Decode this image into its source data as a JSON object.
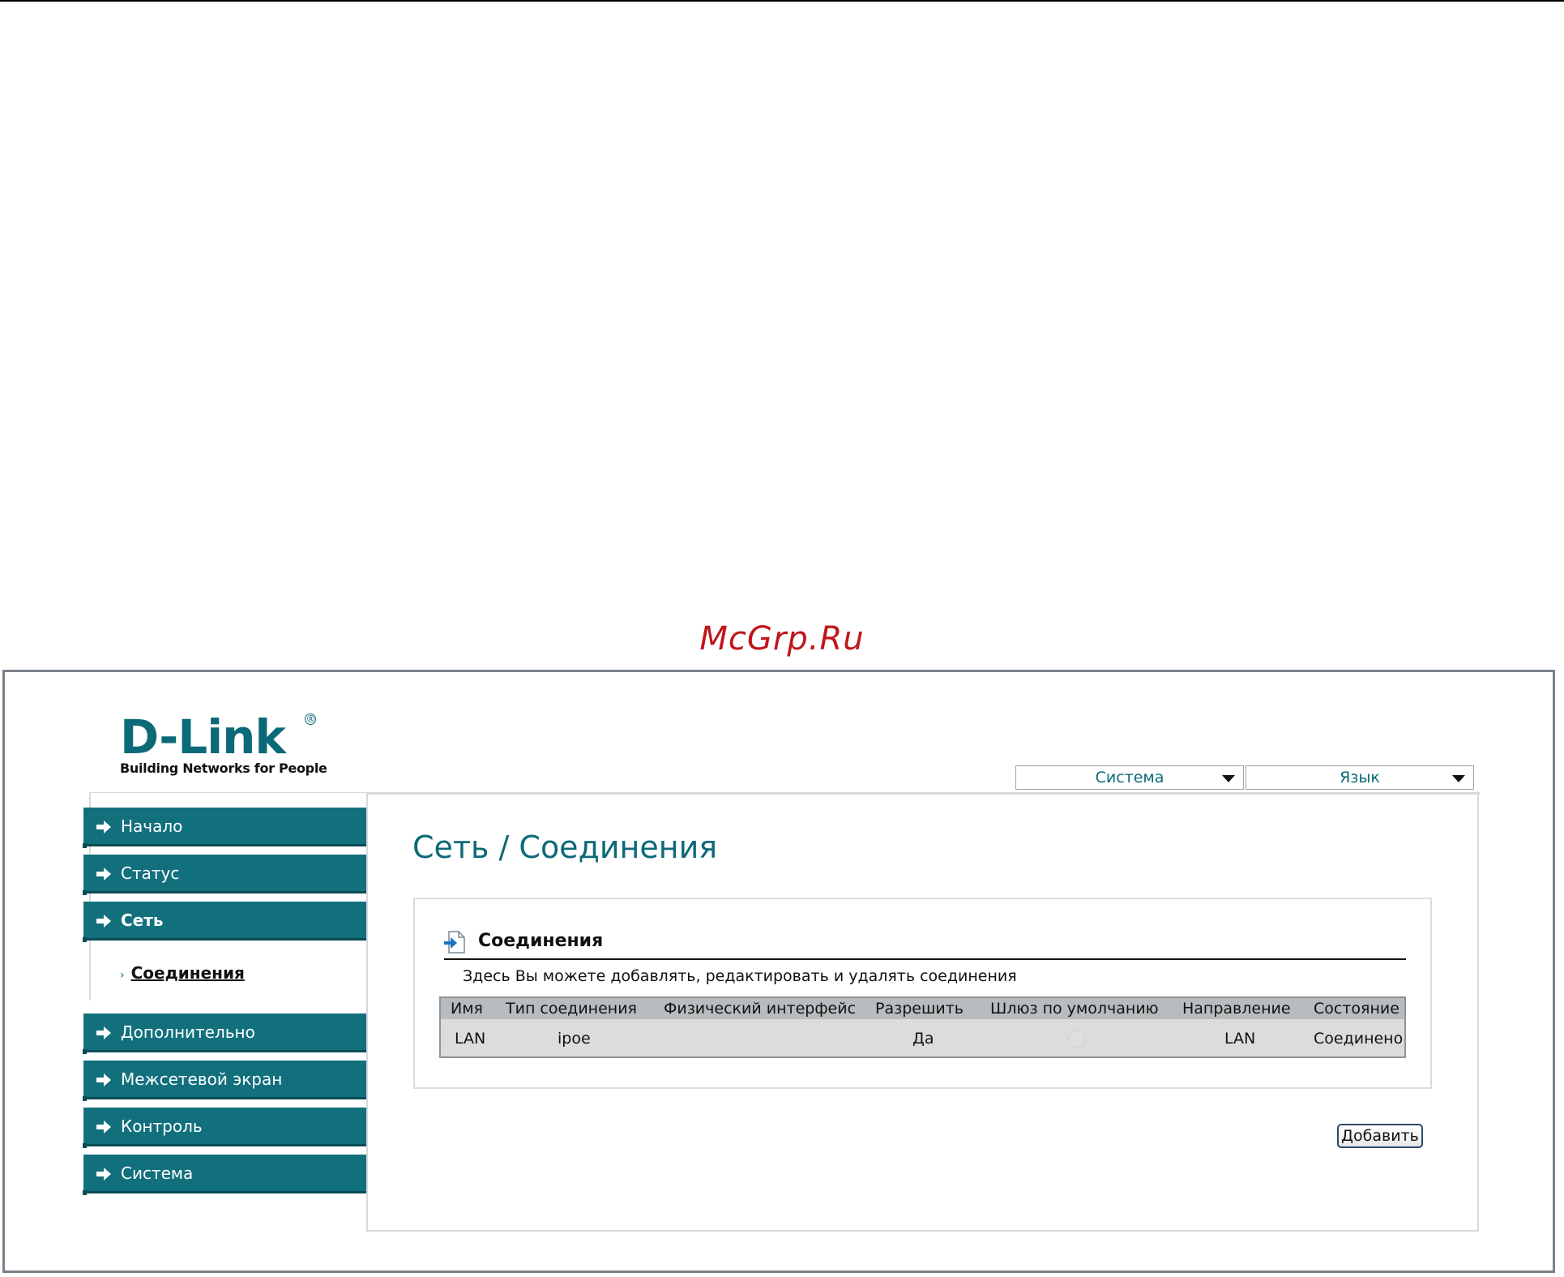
{
  "watermark": "McGrp.Ru",
  "brand": {
    "logo_text": "D-Link",
    "registered_mark": "®",
    "tagline": "Building Networks for People"
  },
  "top_menus": {
    "system_label": "Система",
    "language_label": "Язык"
  },
  "sidebar": {
    "items": [
      {
        "label": "Начало"
      },
      {
        "label": "Статус"
      },
      {
        "label": "Сеть"
      },
      {
        "label": "Дополнительно"
      },
      {
        "label": "Межсетевой экран"
      },
      {
        "label": "Контроль"
      },
      {
        "label": "Система"
      }
    ],
    "subitem": {
      "label": "Соединения"
    }
  },
  "main": {
    "page_title": "Сеть /  Соединения",
    "group": {
      "title": "Соединения",
      "description": "Здесь Вы можете добавлять, редактировать и удалять соединения"
    },
    "table": {
      "headers": [
        "Имя",
        "Тип соединения",
        "Физический интерфейс",
        "Разрешить",
        "Шлюз по умолчанию",
        "Направление",
        "Состояние"
      ],
      "rows": [
        {
          "name": "LAN",
          "type": "ipoe",
          "interface": "",
          "enabled": "Да",
          "direction": "LAN",
          "status": "Соединено"
        }
      ]
    },
    "add_button": "Добавить"
  },
  "colors": {
    "brand_teal": "#12707d",
    "title_teal": "#0c6a78",
    "watermark_red": "#c0161b"
  }
}
